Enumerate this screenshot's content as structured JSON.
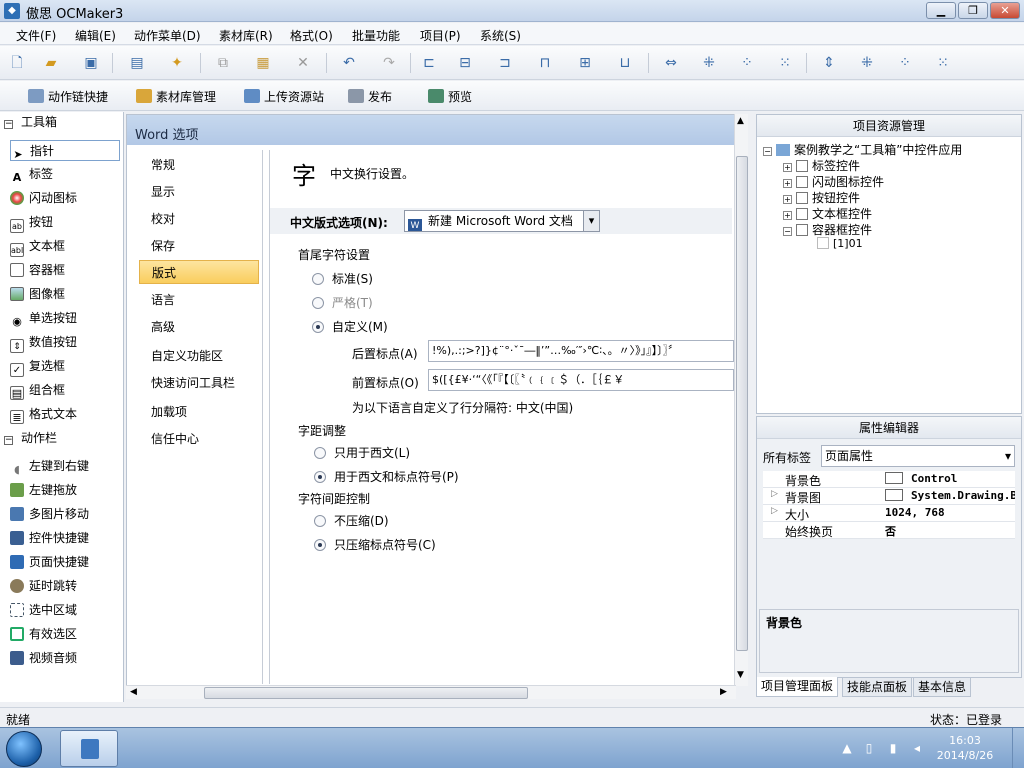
{
  "window": {
    "title": "傲思 OCMaker3",
    "min": "▁",
    "max": "❐",
    "close": "✕"
  },
  "menu": [
    "文件(F)",
    "编辑(E)",
    "动作菜单(D)",
    "素材库(R)",
    "格式(O)",
    "批量功能",
    "项目(P)",
    "系统(S)"
  ],
  "quickbar": {
    "items": [
      "动作链快捷",
      "素材库管理",
      "上传资源站",
      "发布",
      "预览"
    ]
  },
  "toolbox": {
    "header1": "工具箱",
    "tools": [
      "指针",
      "标签",
      "闪动图标",
      "按钮",
      "文本框",
      "容器框",
      "图像框",
      "单选按钮",
      "数值按钮",
      "复选框",
      "组合框",
      "格式文本"
    ],
    "header2": "动作栏",
    "actions": [
      "左键到右键",
      "左键拖放",
      "多图片移动",
      "控件快捷键",
      "页面快捷键",
      "延时跳转",
      "选中区域",
      "有效选区",
      "视频音频"
    ]
  },
  "center": {
    "title": "Word 选项",
    "nav": [
      "常规",
      "显示",
      "校对",
      "保存",
      "版式",
      "语言",
      "高级",
      "自定义功能区",
      "快速访问工具栏",
      "加载项",
      "信任中心"
    ],
    "nav_active": 4,
    "big_icon": "字",
    "heading": "中文换行设置。",
    "layout_label": "中文版式选项(N):",
    "layout_value": "新建 Microsoft Word 文档",
    "section1": "首尾字符设置",
    "opt_standard": "标准(S)",
    "opt_strict": "严格(T)",
    "opt_custom": "自定义(M)",
    "follow_label": "后置标点(A)",
    "follow_value": "!%),.:;>?]}¢¨°·ˇˉ―‖’”…‰′″›℃∶、。〃〉》」』】〕〗〞",
    "lead_label": "前置标点(O)",
    "lead_value": "$([{£¥·‘“〈《「『【〔〖〝﹙﹛﹝＄（．［｛￡￥",
    "note": "为以下语言自定义了行分隔符: 中文(中国)",
    "section2": "字距调整",
    "opt_western": "只用于西文(L)",
    "opt_western_punct": "用于西文和标点符号(P)",
    "section3": "字符间距控制",
    "opt_nocompress": "不压缩(D)",
    "opt_compress_punct": "只压缩标点符号(C)"
  },
  "project": {
    "title": "项目资源管理",
    "root": "案例教学之“工具箱”中控件应用",
    "nodes": [
      "标签控件",
      "闪动图标控件",
      "按钮控件",
      "文本框控件",
      "容器框控件"
    ],
    "leaf": "[1]01"
  },
  "props": {
    "title": "属性编辑器",
    "filter_label": "所有标签",
    "filter_value": "页面属性",
    "rows": [
      {
        "k": "背景色",
        "v": "Control"
      },
      {
        "k": "背景图",
        "v": "System.Drawing.B"
      },
      {
        "k": "大小",
        "v": "1024, 768"
      },
      {
        "k": "始终换页",
        "v": "否"
      }
    ],
    "desc": "背景色"
  },
  "tabs": [
    "项目管理面板",
    "技能点面板",
    "基本信息"
  ],
  "status": {
    "left": "就绪",
    "right": "状态：已登录"
  },
  "taskbar": {
    "time": "16:03",
    "date": "2014/8/26"
  },
  "colors": {
    "accent": "#f9cd5d",
    "titlebar": "#c4d4ea"
  }
}
